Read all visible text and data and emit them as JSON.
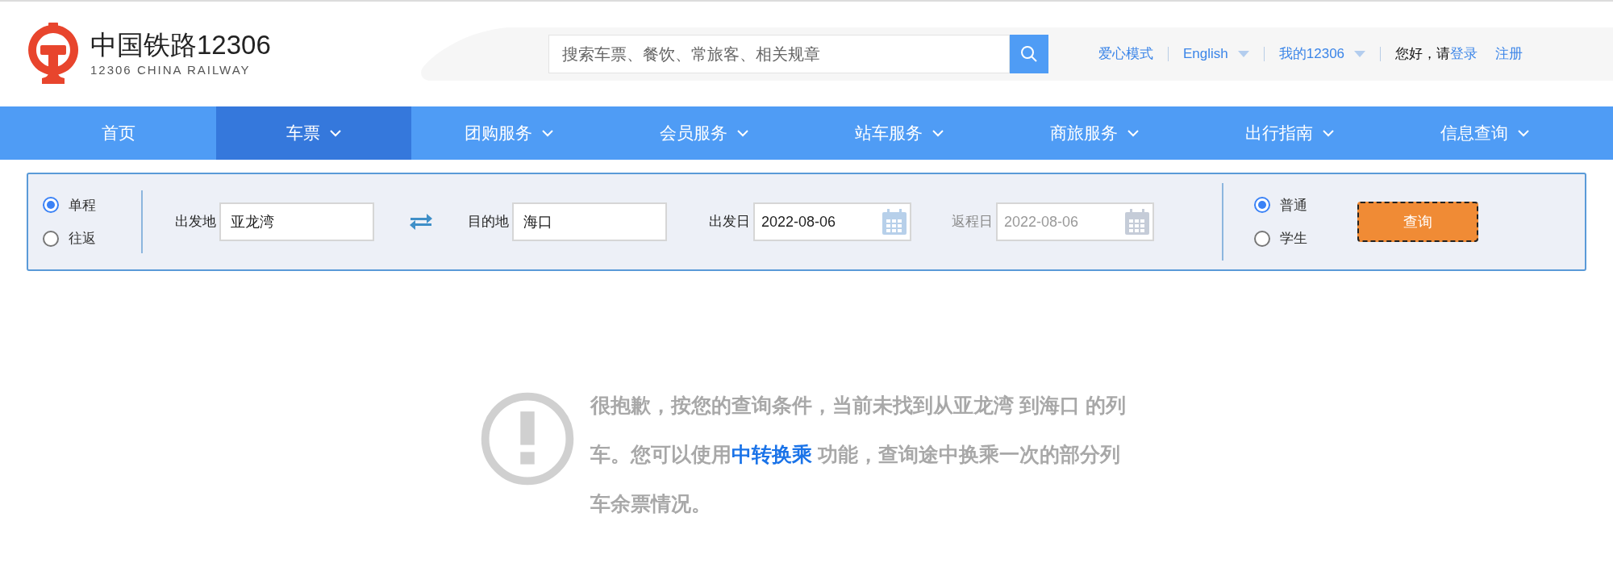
{
  "header": {
    "logo": {
      "title": "中国铁路12306",
      "subtitle": "12306 CHINA RAILWAY"
    },
    "search": {
      "placeholder": "搜索车票、餐饮、常旅客、相关规章"
    },
    "links": [
      {
        "label": "爱心模式",
        "kind": "link"
      },
      {
        "label": "English",
        "kind": "dropdown"
      },
      {
        "label": "我的12306",
        "kind": "dropdown"
      },
      {
        "label": "您好，请",
        "kind": "text"
      },
      {
        "label": "登录",
        "kind": "link"
      },
      {
        "label": "注册",
        "kind": "link"
      }
    ]
  },
  "nav": [
    {
      "label": "首页",
      "selected": false,
      "has_menu": false
    },
    {
      "label": "车票",
      "selected": true,
      "has_menu": true
    },
    {
      "label": "团购服务",
      "selected": false,
      "has_menu": true
    },
    {
      "label": "会员服务",
      "selected": false,
      "has_menu": true
    },
    {
      "label": "站车服务",
      "selected": false,
      "has_menu": true
    },
    {
      "label": "商旅服务",
      "selected": false,
      "has_menu": true
    },
    {
      "label": "出行指南",
      "selected": false,
      "has_menu": true
    },
    {
      "label": "信息查询",
      "selected": false,
      "has_menu": true
    }
  ],
  "search_form": {
    "trip_types": [
      {
        "label": "单程",
        "selected": true
      },
      {
        "label": "往返",
        "selected": false
      }
    ],
    "from": {
      "label": "出发地",
      "value": "亚龙湾"
    },
    "to": {
      "label": "目的地",
      "value": "海口"
    },
    "dates": [
      {
        "label": "出发日",
        "value": "2022-08-06",
        "disabled": false
      },
      {
        "label": "返程日",
        "value": "2022-08-06",
        "disabled": true
      }
    ],
    "passenger_types": [
      {
        "label": "普通",
        "selected": true
      },
      {
        "label": "学生",
        "selected": false
      }
    ],
    "submit": "查询"
  },
  "message": {
    "before": "很抱歉，按您的查询条件，当前未找到从亚龙湾 到海口 的列车。您可以使用",
    "link": "中转换乘",
    "after": " 功能，查询途中换乘一次的部分列车余票情况。"
  }
}
